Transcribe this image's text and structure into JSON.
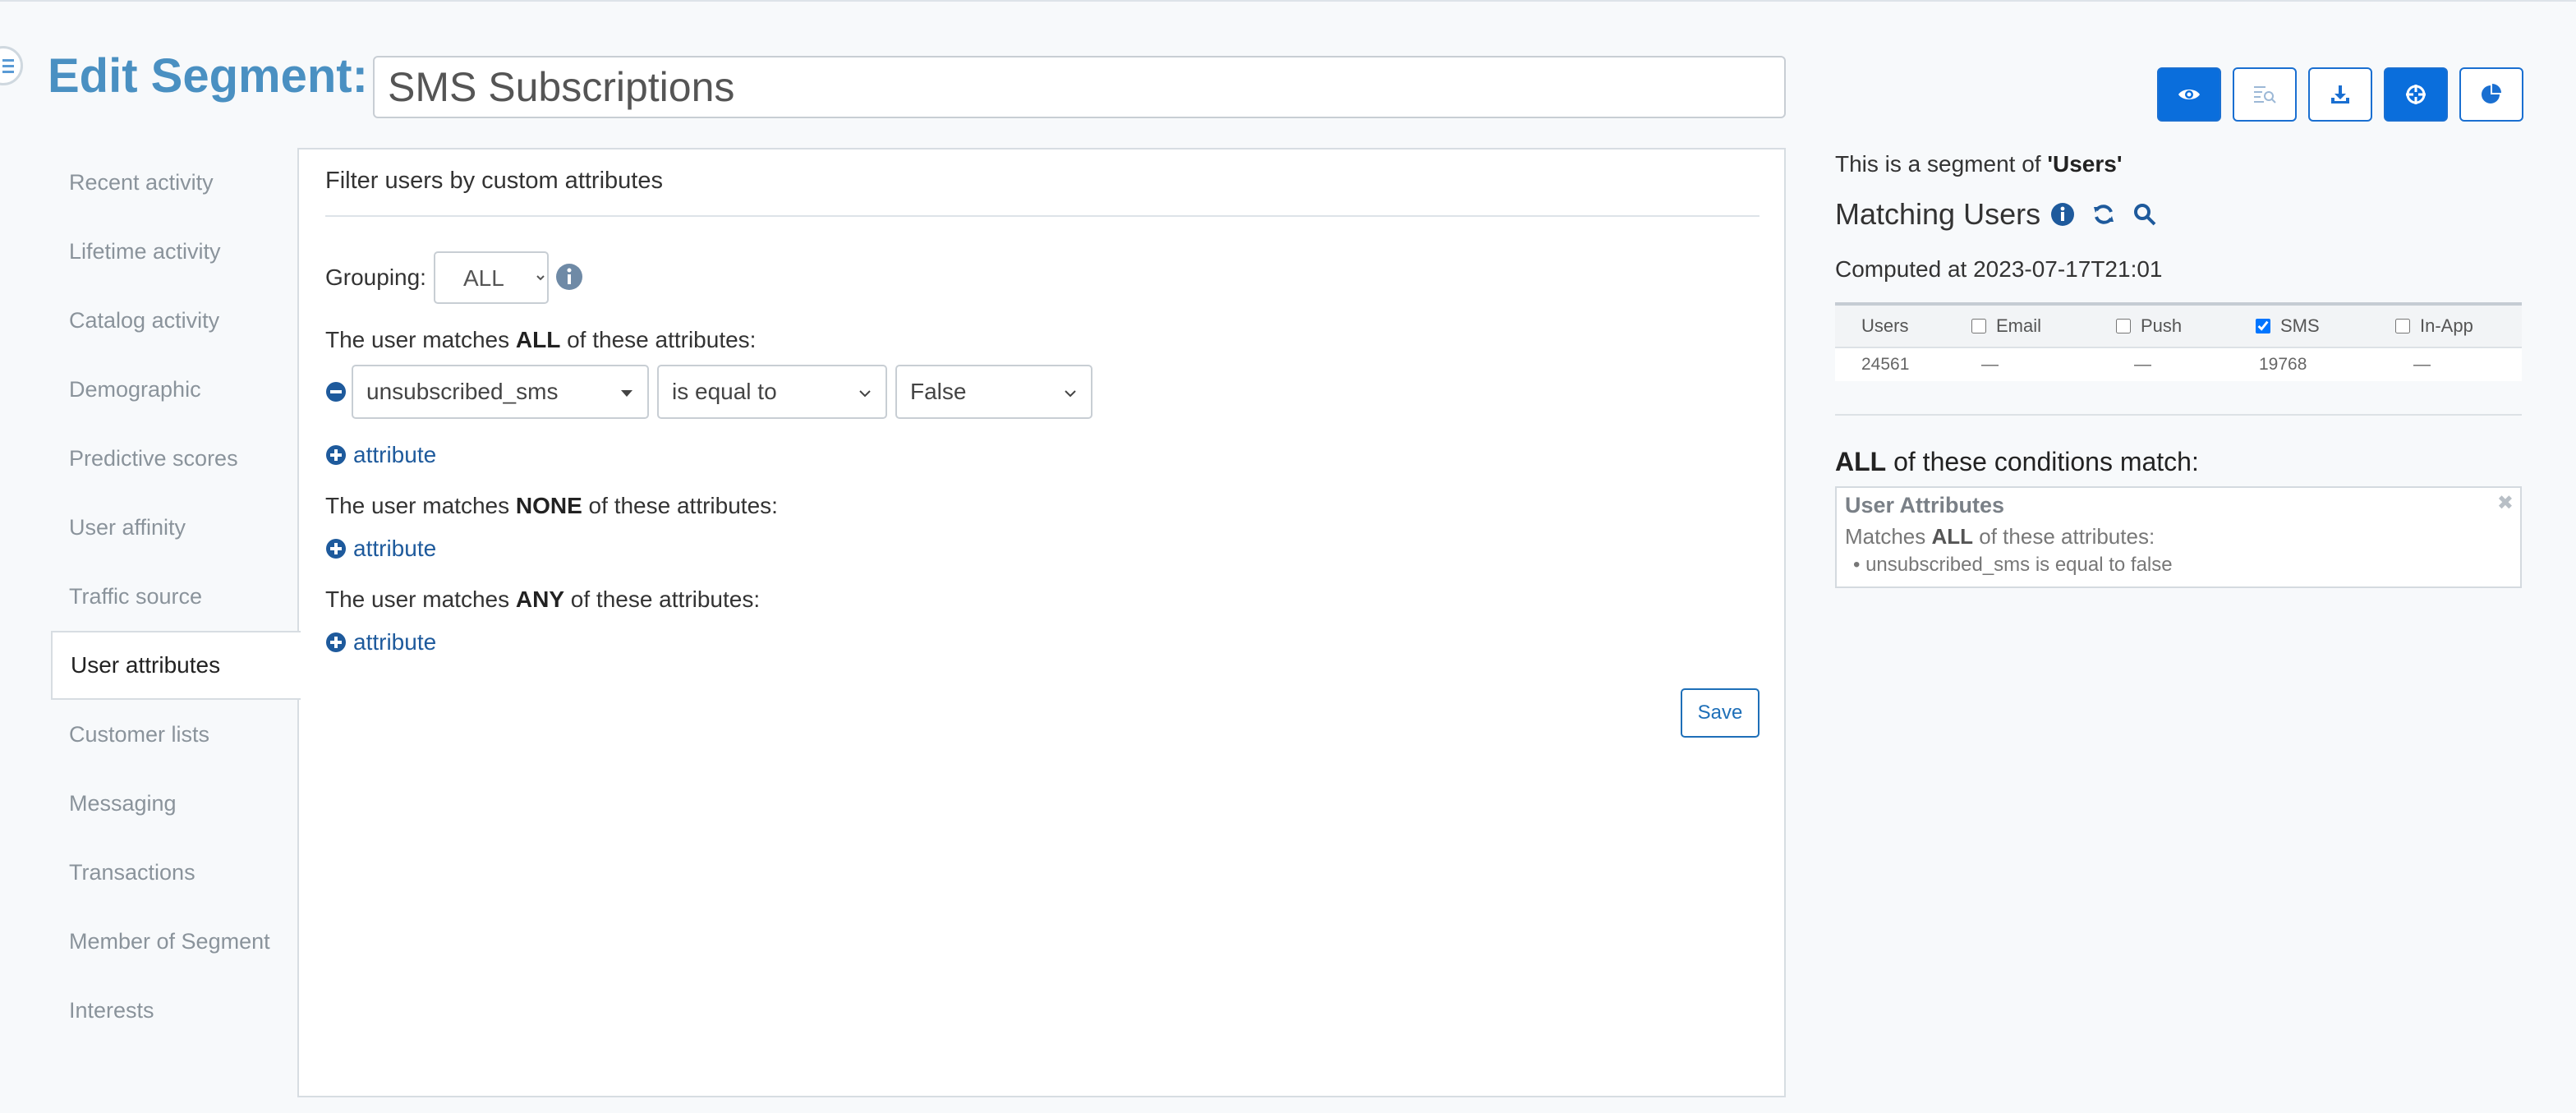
{
  "header": {
    "edit_label": "Edit Segment:",
    "segment_name": "SMS Subscriptions"
  },
  "toolbar": {
    "buttons": [
      {
        "icon": "eye-icon",
        "style": "solid"
      },
      {
        "icon": "search-list-icon",
        "style": "outline"
      },
      {
        "icon": "download-icon",
        "style": "outline"
      },
      {
        "icon": "crosshair-icon",
        "style": "solid"
      },
      {
        "icon": "pie-chart-icon",
        "style": "outline"
      }
    ]
  },
  "sidebar": {
    "items": [
      {
        "label": "Recent activity"
      },
      {
        "label": "Lifetime activity"
      },
      {
        "label": "Catalog activity"
      },
      {
        "label": "Demographic"
      },
      {
        "label": "Predictive scores"
      },
      {
        "label": "User affinity"
      },
      {
        "label": "Traffic source"
      },
      {
        "label": "User attributes",
        "active": true
      },
      {
        "label": "Customer lists"
      },
      {
        "label": "Messaging"
      },
      {
        "label": "Transactions"
      },
      {
        "label": "Member of Segment"
      },
      {
        "label": "Interests"
      }
    ]
  },
  "filter": {
    "title": "Filter users by custom attributes",
    "grouping_label": "Grouping:",
    "grouping_value": "ALL",
    "all_prefix": "The user matches ",
    "all_bold": "ALL",
    "all_suffix": " of these attributes:",
    "condition": {
      "attribute": "unsubscribed_sms",
      "operator": "is equal to",
      "value": "False"
    },
    "add_label": "attribute",
    "none_prefix": "The user matches ",
    "none_bold": "NONE",
    "none_suffix": " of these attributes:",
    "any_prefix": "The user matches ",
    "any_bold": "ANY",
    "any_suffix": " of these attributes:",
    "save_label": "Save"
  },
  "summary": {
    "segment_of_prefix": "This is a segment of ",
    "segment_of_value": "'Users'",
    "matching_title": "Matching Users",
    "computed": "Computed at 2023-07-17T21:01",
    "columns": [
      {
        "label": "Users",
        "checkbox": false
      },
      {
        "label": "Email",
        "checkbox": true,
        "checked": false
      },
      {
        "label": "Push",
        "checkbox": true,
        "checked": false
      },
      {
        "label": "SMS",
        "checkbox": true,
        "checked": true
      },
      {
        "label": "In-App",
        "checkbox": true,
        "checked": false
      }
    ],
    "values": [
      "24561",
      "—",
      "—",
      "19768",
      "—"
    ],
    "conditions_bold": "ALL",
    "conditions_suffix": " of these conditions match:",
    "box_title": "User Attributes",
    "box_sub_prefix": "Matches ",
    "box_sub_bold": "ALL",
    "box_sub_suffix": " of these attributes:",
    "box_item": "• unsubscribed_sms is equal to false",
    "close_glyph": "✖"
  },
  "colors": {
    "accent": "#4a90c2",
    "primary_button": "#0a6edc",
    "link": "#1e5a9c"
  }
}
